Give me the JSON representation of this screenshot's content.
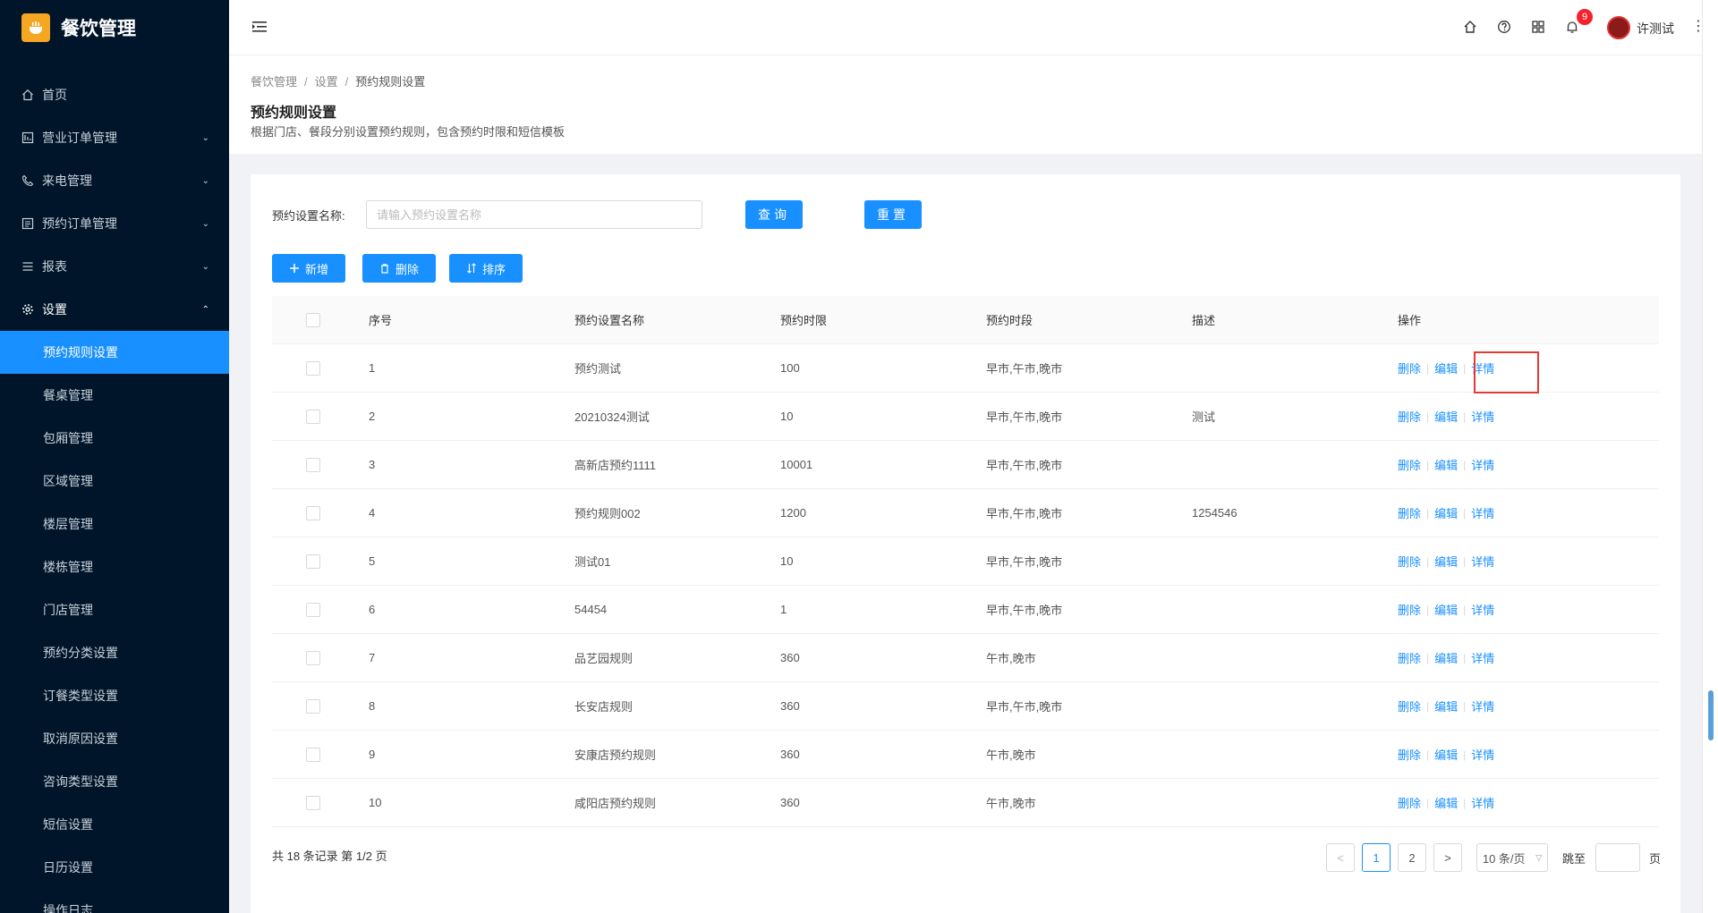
{
  "app": {
    "title": "餐饮管理"
  },
  "sidebar": {
    "menu": [
      {
        "label": "首页",
        "icon": "home-icon"
      },
      {
        "label": "营业订单管理",
        "icon": "order-icon",
        "arrow": "⌄"
      },
      {
        "label": "来电管理",
        "icon": "phone-icon",
        "arrow": "⌄"
      },
      {
        "label": "预约订单管理",
        "icon": "list-icon",
        "arrow": "⌄"
      },
      {
        "label": "报表",
        "icon": "report-icon",
        "arrow": "⌄"
      },
      {
        "label": "设置",
        "icon": "gear-icon",
        "arrow": "⌃"
      }
    ],
    "submenu": [
      "预约规则设置",
      "餐桌管理",
      "包厢管理",
      "区域管理",
      "楼层管理",
      "楼栋管理",
      "门店管理",
      "预约分类设置",
      "订餐类型设置",
      "取消原因设置",
      "咨询类型设置",
      "短信设置",
      "日历设置",
      "操作日志"
    ],
    "active_submenu": "预约规则设置"
  },
  "header": {
    "notification_count": "9",
    "username": "许测试"
  },
  "breadcrumb": [
    "餐饮管理",
    "设置",
    "预约规则设置"
  ],
  "page": {
    "title": "预约规则设置",
    "description": "根据门店、餐段分别设置预约规则，包含预约时限和短信模板"
  },
  "filter": {
    "label": "预约设置名称:",
    "placeholder": "请输入预约设置名称",
    "query_label": "查询",
    "reset_label": "重置"
  },
  "toolbar": {
    "add_label": "新增",
    "delete_label": "删除",
    "sort_label": "排序"
  },
  "table": {
    "columns": [
      "序号",
      "预约设置名称",
      "预约时限",
      "预约时段",
      "描述",
      "操作"
    ],
    "ops": [
      "删除",
      "编辑",
      "详情"
    ],
    "rows": [
      {
        "no": "1",
        "name": "预约测试",
        "limit": "100",
        "period": "早市,午市,晚市",
        "desc": ""
      },
      {
        "no": "2",
        "name": "20210324测试",
        "limit": "10",
        "period": "早市,午市,晚市",
        "desc": "测试"
      },
      {
        "no": "3",
        "name": "高新店预约1111",
        "limit": "10001",
        "period": "早市,午市,晚市",
        "desc": ""
      },
      {
        "no": "4",
        "name": "预约规则002",
        "limit": "1200",
        "period": "早市,午市,晚市",
        "desc": "1254546"
      },
      {
        "no": "5",
        "name": "测试01",
        "limit": "10",
        "period": "早市,午市,晚市",
        "desc": ""
      },
      {
        "no": "6",
        "name": "54454",
        "limit": "1",
        "period": "早市,午市,晚市",
        "desc": ""
      },
      {
        "no": "7",
        "name": "品艺园规则",
        "limit": "360",
        "period": "午市,晚市",
        "desc": ""
      },
      {
        "no": "8",
        "name": "长安店规则",
        "limit": "360",
        "period": "早市,午市,晚市",
        "desc": ""
      },
      {
        "no": "9",
        "name": "安康店预约规则",
        "limit": "360",
        "period": "午市,晚市",
        "desc": ""
      },
      {
        "no": "10",
        "name": "咸阳店预约规则",
        "limit": "360",
        "period": "午市,晚市",
        "desc": ""
      }
    ]
  },
  "pagination": {
    "total_text": "共 18 条记录 第 1/2 页",
    "pages": [
      "1",
      "2"
    ],
    "current": "1",
    "page_size": "10 条/页",
    "jump_label": "跳至",
    "page_suffix": "页"
  }
}
